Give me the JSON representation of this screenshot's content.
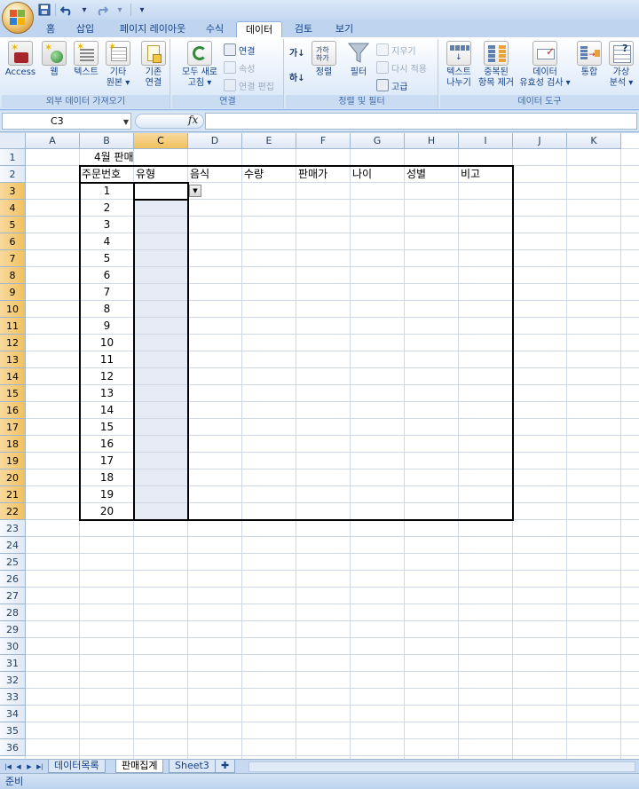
{
  "quick_access": {
    "save_icon": "save-icon",
    "undo_icon": "undo-icon",
    "redo_icon": "redo-icon",
    "customize_icon": "customize-qat-icon"
  },
  "tabs": [
    "홈",
    "삽입",
    "페이지 레이아웃",
    "수식",
    "데이터",
    "검토",
    "보기"
  ],
  "active_tab": "데이터",
  "ribbon": {
    "external_data": {
      "label": "외부 데이터 가져오기",
      "access": "Access",
      "web": "웹",
      "text": "텍스트",
      "other_line1": "기타",
      "other_line2": "원본",
      "existing_line1": "기존",
      "existing_line2": "연결"
    },
    "connections": {
      "label": "연결",
      "refresh_line1": "모두 새로",
      "refresh_line2": "고침",
      "connections": "연결",
      "properties": "속성",
      "edit_links": "연결 편집"
    },
    "sort_filter": {
      "label": "정렬 및 필터",
      "sort": "정렬",
      "filter": "필터",
      "clear": "지우기",
      "reapply": "다시 적용",
      "advanced": "고급"
    },
    "data_tools": {
      "label": "데이터 도구",
      "text_to_columns_line1": "텍스트",
      "text_to_columns_line2": "나누기",
      "remove_dup_line1": "중복된",
      "remove_dup_line2": "항목 제거",
      "validation_line1": "데이터",
      "validation_line2": "유효성 검사",
      "consolidate": "통합",
      "whatif_line1": "가상",
      "whatif_line2": "분석"
    }
  },
  "formula_bar": {
    "name_box": "C3",
    "fx_label": "fx",
    "formula": ""
  },
  "columns": [
    "A",
    "B",
    "C",
    "D",
    "E",
    "F",
    "G",
    "H",
    "I",
    "J",
    "K"
  ],
  "rows": [
    "1",
    "2",
    "3",
    "4",
    "5",
    "6",
    "7",
    "8",
    "9",
    "10",
    "11",
    "12",
    "13",
    "14",
    "15",
    "16",
    "17",
    "18",
    "19",
    "20",
    "21",
    "22",
    "23",
    "24",
    "25",
    "26",
    "27",
    "28",
    "29",
    "30",
    "31",
    "32",
    "33",
    "34",
    "35",
    "36"
  ],
  "selected_column": "C",
  "selected_rows": [
    "3",
    "4",
    "5",
    "6",
    "7",
    "8",
    "9",
    "10",
    "11",
    "12",
    "13",
    "14",
    "15",
    "16",
    "17",
    "18",
    "19",
    "20",
    "21",
    "22"
  ],
  "sheet": {
    "title": "4월 판매",
    "headers": [
      "주문번호",
      "유형",
      "음식",
      "수량",
      "판매가",
      "나이",
      "성별",
      "비고"
    ],
    "order_numbers": [
      "1",
      "2",
      "3",
      "4",
      "5",
      "6",
      "7",
      "8",
      "9",
      "10",
      "11",
      "12",
      "13",
      "14",
      "15",
      "16",
      "17",
      "18",
      "19",
      "20"
    ]
  },
  "sheet_tabs": [
    "데이터목록",
    "판매집계",
    "Sheet3"
  ],
  "active_sheet": "판매집계",
  "status": "준비"
}
